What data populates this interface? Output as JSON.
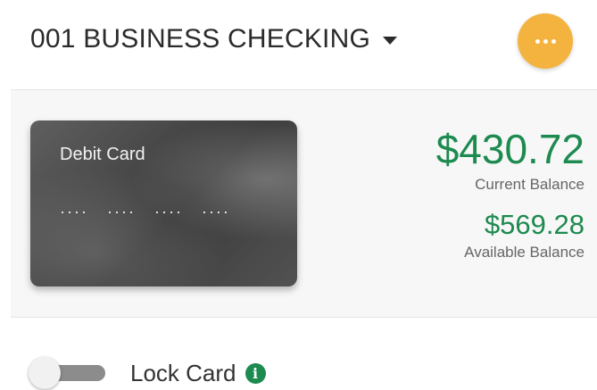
{
  "account": {
    "name": "001 BUSINESS CHECKING",
    "dropdown_icon": "caret-down-icon",
    "more_icon": "more-horizontal-icon"
  },
  "card": {
    "label": "Debit Card",
    "number_mask": "···· ···· ···· ····"
  },
  "balances": {
    "current_value": "$430.72",
    "current_label": "Current Balance",
    "available_value": "$569.28",
    "available_label": "Available Balance"
  },
  "lock": {
    "label": "Lock Card",
    "enabled": false,
    "info_icon_glyph": "i"
  },
  "colors": {
    "accent_orange": "#f4b33f",
    "money_green": "#1d8a4f",
    "toggle_track": "#8c8c8c",
    "card_dark": "#3b3b3b"
  }
}
